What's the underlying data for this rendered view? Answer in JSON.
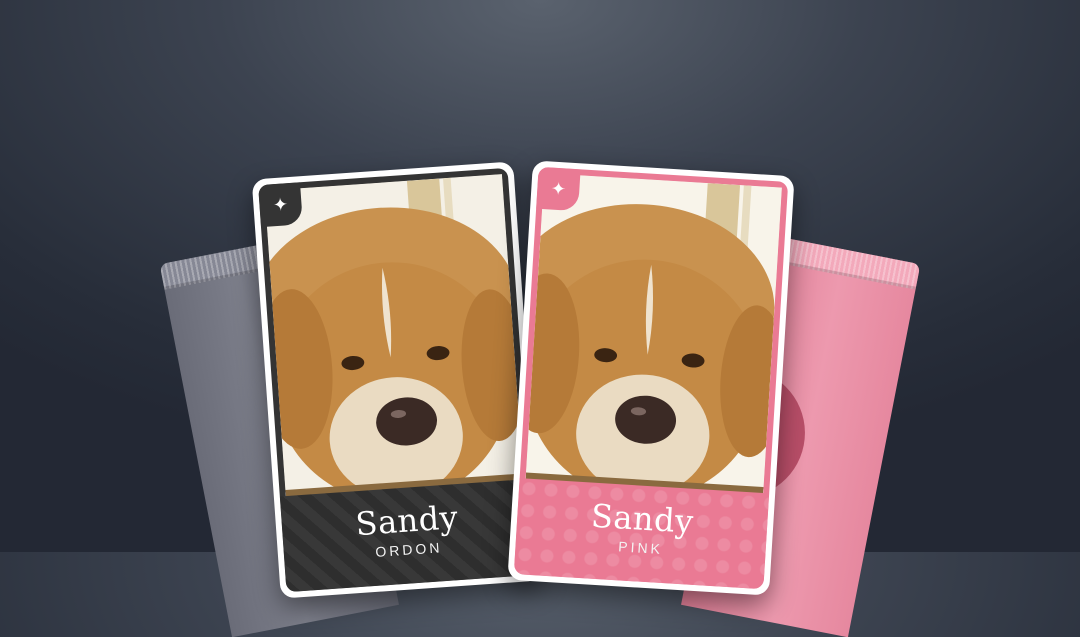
{
  "cards": {
    "grey": {
      "name": "Sandy",
      "subtitle": "ORDON",
      "corner_icon": "sparkle-icon"
    },
    "pink": {
      "name": "Sandy",
      "subtitle": "PINK",
      "corner_icon": "sparkle-icon"
    }
  },
  "colors": {
    "background": "#2b303c",
    "grey_card": "#343434",
    "pink_card": "#ea7a94",
    "grey_pack": "#787a86",
    "pink_pack": "#eb95aa"
  }
}
